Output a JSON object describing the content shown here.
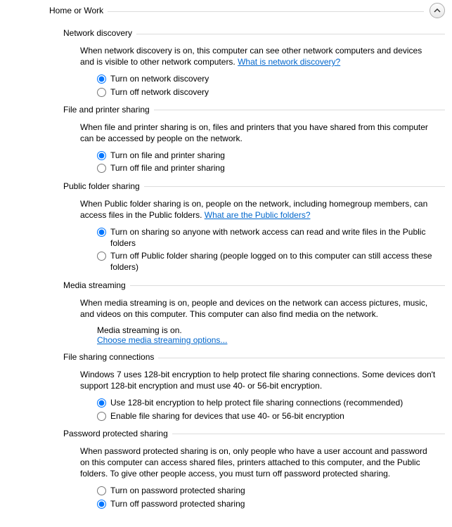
{
  "profile": {
    "title": "Home or Work"
  },
  "sections": {
    "networkDiscovery": {
      "title": "Network discovery",
      "desc": "When network discovery is on, this computer can see other network computers and devices and is visible to other network computers. ",
      "link": "What is network discovery?",
      "opt1": "Turn on network discovery",
      "opt2": "Turn off network discovery"
    },
    "filePrinter": {
      "title": "File and printer sharing",
      "desc": "When file and printer sharing is on, files and printers that you have shared from this computer can be accessed by people on the network.",
      "opt1": "Turn on file and printer sharing",
      "opt2": "Turn off file and printer sharing"
    },
    "publicFolder": {
      "title": "Public folder sharing",
      "desc": "When Public folder sharing is on, people on the network, including homegroup members, can access files in the Public folders. ",
      "link": "What are the Public folders?",
      "opt1": "Turn on sharing so anyone with network access can read and write files in the Public folders",
      "opt2": "Turn off Public folder sharing (people logged on to this computer can still access these folders)"
    },
    "mediaStreaming": {
      "title": "Media streaming",
      "desc": "When media streaming is on, people and devices on the network can access pictures, music, and videos on this computer. This computer can also find media on the network.",
      "status": "Media streaming is on.",
      "link": "Choose media streaming options..."
    },
    "fileSharingConn": {
      "title": "File sharing connections",
      "desc": "Windows 7 uses 128-bit encryption to help protect file sharing connections. Some devices don't support 128-bit encryption and must use 40- or 56-bit encryption.",
      "opt1": "Use 128-bit encryption to help protect file sharing connections (recommended)",
      "opt2": "Enable file sharing for devices that use 40- or 56-bit encryption"
    },
    "passwordProtected": {
      "title": "Password protected sharing",
      "desc": "When password protected sharing is on, only people who have a user account and password on this computer can access shared files, printers attached to this computer, and the Public folders. To give other people access, you must turn off password protected sharing.",
      "opt1": "Turn on password protected sharing",
      "opt2": "Turn off password protected sharing"
    }
  }
}
